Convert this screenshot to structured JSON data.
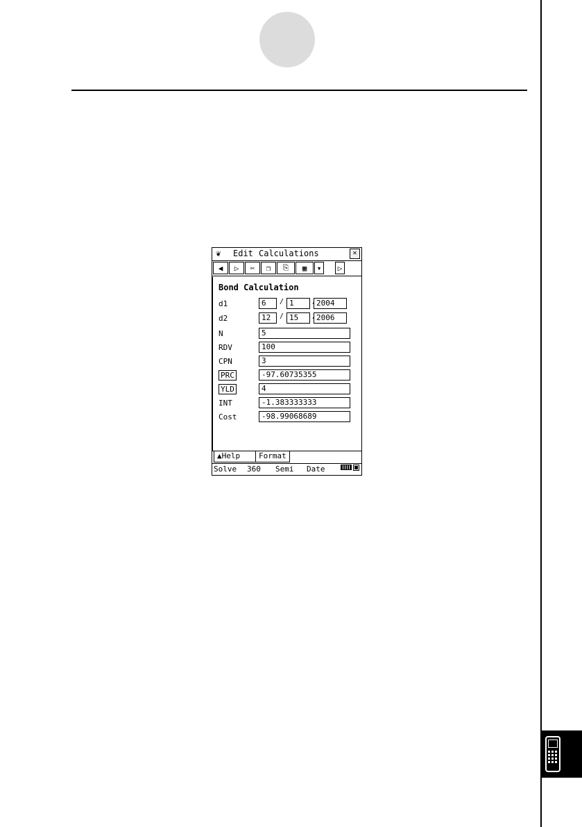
{
  "window": {
    "menu": [
      "Edit",
      "Calculations"
    ],
    "close_icon": "close-x-icon"
  },
  "toolbar": {
    "icons": [
      "back-arrow-icon",
      "play-icon",
      "cut-icon",
      "copy-icon",
      "paste-icon",
      "table-icon",
      "dropdown-icon",
      "scroll-right-icon"
    ]
  },
  "form": {
    "title": "Bond Calculation",
    "d1": {
      "label": "d1",
      "month": "6",
      "day": "1",
      "year": "2004"
    },
    "d2": {
      "label": "d2",
      "month": "12",
      "day": "15",
      "year": "2006"
    },
    "date_sep": "/",
    "fields": [
      {
        "label": "N",
        "value": "5"
      },
      {
        "label": "RDV",
        "value": "100"
      },
      {
        "label": "CPN",
        "value": "3"
      },
      {
        "label": "PRC",
        "value": "-97.60735355"
      },
      {
        "label": "YLD",
        "value": "4"
      },
      {
        "label": "INT",
        "value": "-1.383333333"
      },
      {
        "label": "Cost",
        "value": "-98.99068689"
      }
    ]
  },
  "tabs": [
    "▲Help",
    "Format"
  ],
  "status": [
    "Solve",
    "360",
    "Semi",
    "Date"
  ]
}
